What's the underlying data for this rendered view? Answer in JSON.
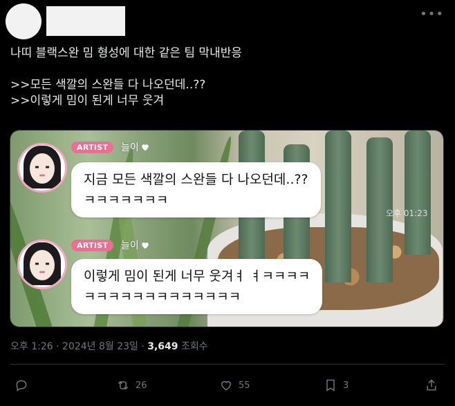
{
  "tweet": {
    "text": "나띠 블랙스완 밈 형성에 대한 같은 팀 막내반응\n\n>>모든 색깔의 스완들 다 나오던데..??\n>>이렇게 밈이 된게 너무 웃겨",
    "more_icon": "more-horizontal-icon"
  },
  "media": {
    "watermark": "오후 01:23",
    "messages": [
      {
        "badge": "ARTIST",
        "name": "늘이",
        "text": "지금 모든 색깔의 스완들 다 나오던데..??\nㅋㅋㅋㅋㅋㅋㅋ"
      },
      {
        "badge": "ARTIST",
        "name": "늘이",
        "text": "이렇게 밈이 된게 너무 웃겨ㅕ ㅕㅋㅋㅋㅋ\nㅋㅋㅋㅋㅋㅋㅋㅋㅋㅋㅋㅋㅋ"
      }
    ]
  },
  "meta": {
    "datetime": "오후 1:26 · 2024년 8월 23일 · ",
    "views_count": "3,649",
    "views_label": " 조회수"
  },
  "actions": {
    "reply": {
      "icon": "reply-icon",
      "count": ""
    },
    "retweet": {
      "icon": "retweet-icon",
      "count": "26"
    },
    "like": {
      "icon": "heart-icon",
      "count": "55"
    },
    "bookmark": {
      "icon": "bookmark-icon",
      "count": "3"
    },
    "share": {
      "icon": "share-icon",
      "count": ""
    }
  },
  "colors": {
    "background": "#000000",
    "text": "#e7e9ea",
    "muted": "#71767b",
    "artist_badge": "#f06c92",
    "avatar_ring": "#f3a9bf"
  }
}
